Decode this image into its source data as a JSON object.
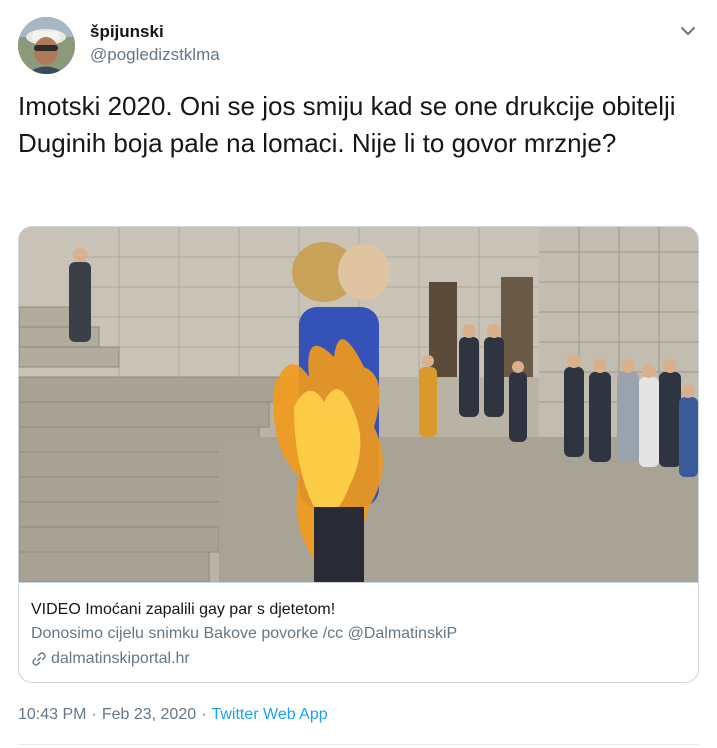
{
  "user": {
    "display_name": "špijunski",
    "handle": "@pogledizstklma"
  },
  "tweet": {
    "text": "Imotski 2020. Oni se jos smiju kad se one drukcije obitelji Duginih boja pale na lomaci. Nije li to govor mrznje?"
  },
  "card": {
    "title": "VIDEO Imoćani zapalili gay par s djetetom!",
    "description": "Donosimo cijelu snimku Bakove povorke /cc @DalmatinskiP",
    "domain": "dalmatinskiportal.hr",
    "icon": "link-icon"
  },
  "meta": {
    "time": "10:43 PM",
    "separator": "·",
    "date": "Feb 23, 2020",
    "source": "Twitter Web App"
  },
  "colors": {
    "text": "#14171a",
    "secondary": "#657786",
    "accent": "#1da1f2",
    "border": "#ccd6dd"
  }
}
